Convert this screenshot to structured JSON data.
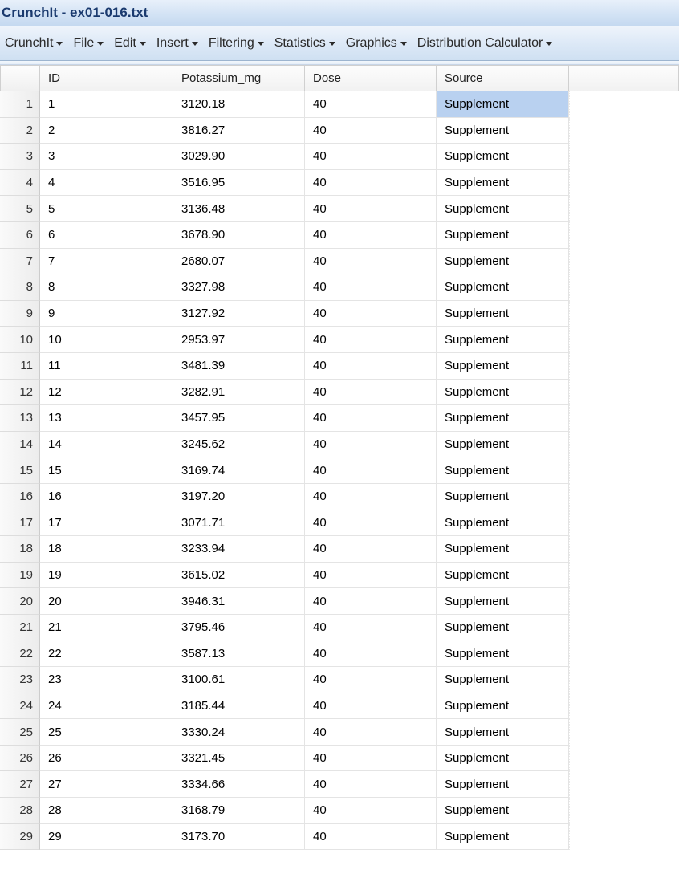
{
  "title": "CrunchIt - ex01-016.txt",
  "menu": [
    {
      "label": "CrunchIt"
    },
    {
      "label": "File"
    },
    {
      "label": "Edit"
    },
    {
      "label": "Insert"
    },
    {
      "label": "Filtering"
    },
    {
      "label": "Statistics"
    },
    {
      "label": "Graphics"
    },
    {
      "label": "Distribution Calculator"
    }
  ],
  "columns": [
    "ID",
    "Potassium_mg",
    "Dose",
    "Source"
  ],
  "rows": [
    {
      "n": "1",
      "id": "1",
      "pot": "3120.18",
      "dose": "40",
      "src": "Supplement",
      "sel": true
    },
    {
      "n": "2",
      "id": "2",
      "pot": "3816.27",
      "dose": "40",
      "src": "Supplement"
    },
    {
      "n": "3",
      "id": "3",
      "pot": "3029.90",
      "dose": "40",
      "src": "Supplement"
    },
    {
      "n": "4",
      "id": "4",
      "pot": "3516.95",
      "dose": "40",
      "src": "Supplement"
    },
    {
      "n": "5",
      "id": "5",
      "pot": "3136.48",
      "dose": "40",
      "src": "Supplement"
    },
    {
      "n": "6",
      "id": "6",
      "pot": "3678.90",
      "dose": "40",
      "src": "Supplement"
    },
    {
      "n": "7",
      "id": "7",
      "pot": "2680.07",
      "dose": "40",
      "src": "Supplement"
    },
    {
      "n": "8",
      "id": "8",
      "pot": "3327.98",
      "dose": "40",
      "src": "Supplement"
    },
    {
      "n": "9",
      "id": "9",
      "pot": "3127.92",
      "dose": "40",
      "src": "Supplement"
    },
    {
      "n": "10",
      "id": "10",
      "pot": "2953.97",
      "dose": "40",
      "src": "Supplement"
    },
    {
      "n": "11",
      "id": "11",
      "pot": "3481.39",
      "dose": "40",
      "src": "Supplement"
    },
    {
      "n": "12",
      "id": "12",
      "pot": "3282.91",
      "dose": "40",
      "src": "Supplement"
    },
    {
      "n": "13",
      "id": "13",
      "pot": "3457.95",
      "dose": "40",
      "src": "Supplement"
    },
    {
      "n": "14",
      "id": "14",
      "pot": "3245.62",
      "dose": "40",
      "src": "Supplement"
    },
    {
      "n": "15",
      "id": "15",
      "pot": "3169.74",
      "dose": "40",
      "src": "Supplement"
    },
    {
      "n": "16",
      "id": "16",
      "pot": "3197.20",
      "dose": "40",
      "src": "Supplement"
    },
    {
      "n": "17",
      "id": "17",
      "pot": "3071.71",
      "dose": "40",
      "src": "Supplement"
    },
    {
      "n": "18",
      "id": "18",
      "pot": "3233.94",
      "dose": "40",
      "src": "Supplement"
    },
    {
      "n": "19",
      "id": "19",
      "pot": "3615.02",
      "dose": "40",
      "src": "Supplement"
    },
    {
      "n": "20",
      "id": "20",
      "pot": "3946.31",
      "dose": "40",
      "src": "Supplement"
    },
    {
      "n": "21",
      "id": "21",
      "pot": "3795.46",
      "dose": "40",
      "src": "Supplement"
    },
    {
      "n": "22",
      "id": "22",
      "pot": "3587.13",
      "dose": "40",
      "src": "Supplement"
    },
    {
      "n": "23",
      "id": "23",
      "pot": "3100.61",
      "dose": "40",
      "src": "Supplement"
    },
    {
      "n": "24",
      "id": "24",
      "pot": "3185.44",
      "dose": "40",
      "src": "Supplement"
    },
    {
      "n": "25",
      "id": "25",
      "pot": "3330.24",
      "dose": "40",
      "src": "Supplement"
    },
    {
      "n": "26",
      "id": "26",
      "pot": "3321.45",
      "dose": "40",
      "src": "Supplement"
    },
    {
      "n": "27",
      "id": "27",
      "pot": "3334.66",
      "dose": "40",
      "src": "Supplement"
    },
    {
      "n": "28",
      "id": "28",
      "pot": "3168.79",
      "dose": "40",
      "src": "Supplement"
    },
    {
      "n": "29",
      "id": "29",
      "pot": "3173.70",
      "dose": "40",
      "src": "Supplement"
    }
  ]
}
